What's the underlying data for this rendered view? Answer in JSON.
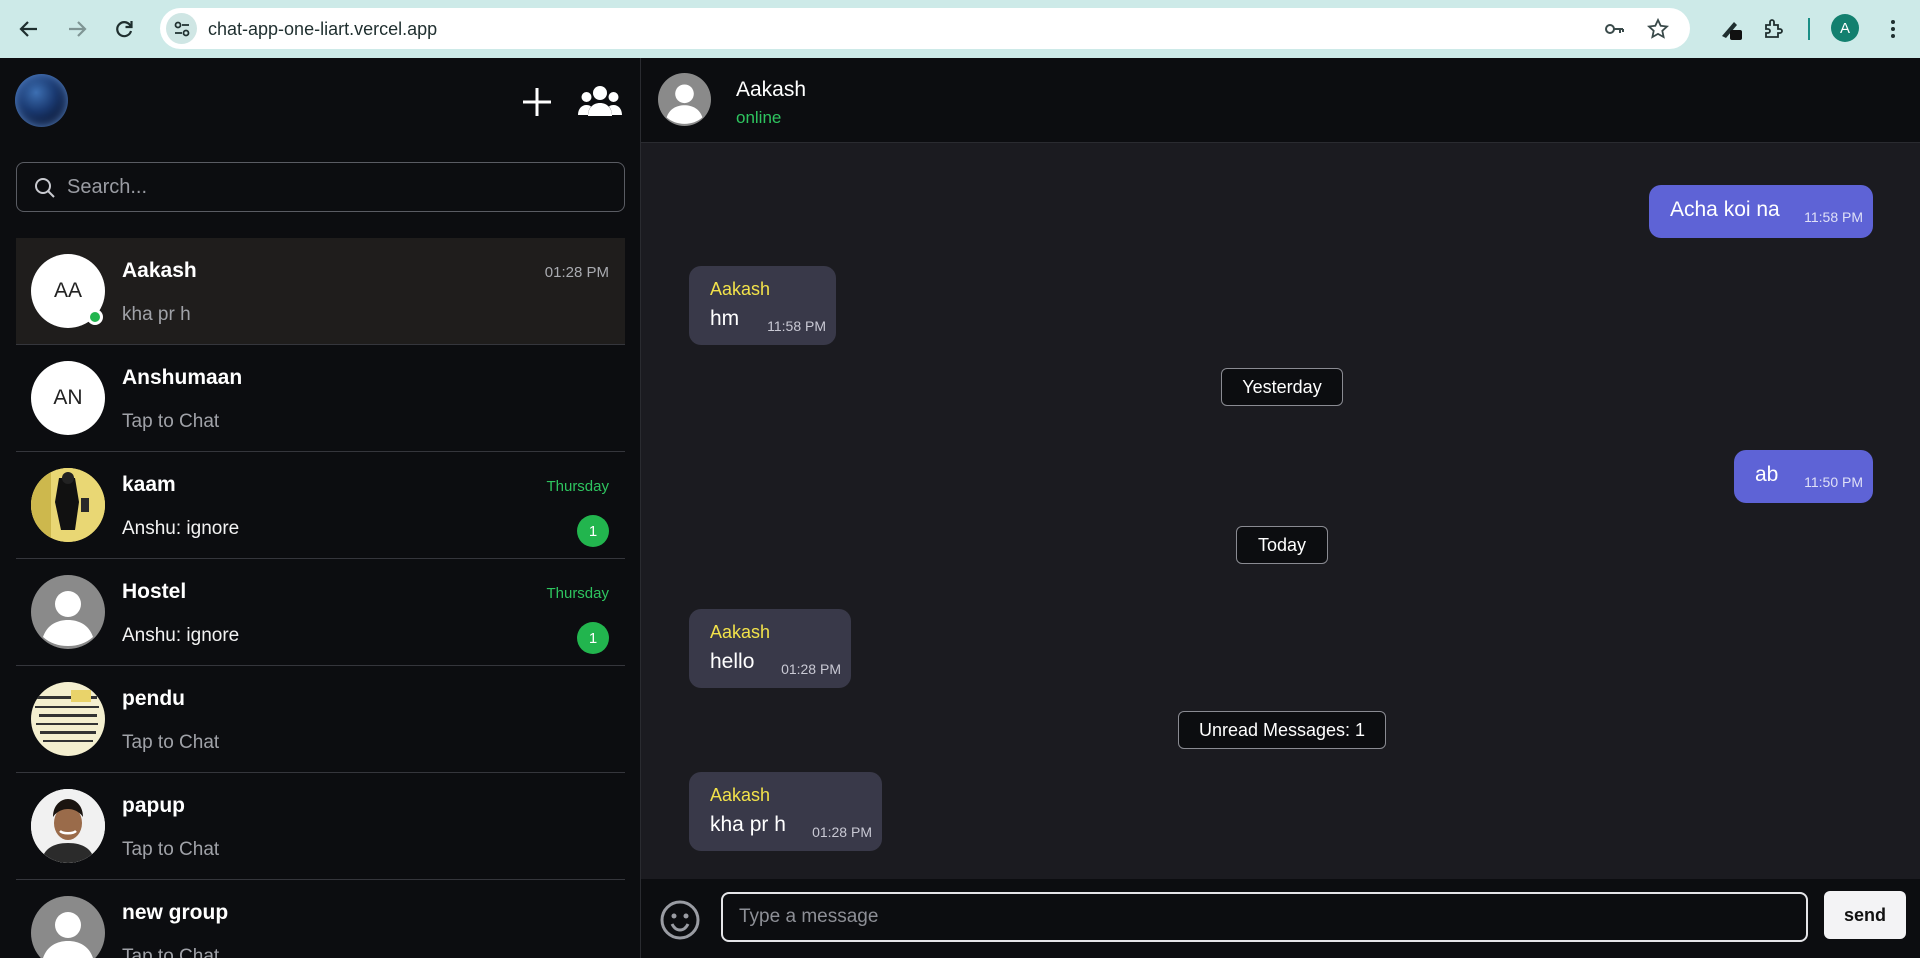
{
  "browser": {
    "url": "chat-app-one-liart.vercel.app",
    "profile_initial": "A"
  },
  "sidebar": {
    "search_placeholder": "Search...",
    "chats": [
      {
        "name": "Aakash",
        "initials": "AA",
        "time": "01:28 PM",
        "preview": "kha pr h",
        "online": true,
        "active": true
      },
      {
        "name": "Anshumaan",
        "initials": "AN",
        "time": "",
        "preview": "Tap to Chat"
      },
      {
        "name": "kaam",
        "time": "Thursday",
        "preview": "Anshu: ignore",
        "unread": "1"
      },
      {
        "name": "Hostel",
        "time": "Thursday",
        "preview": "Anshu: ignore",
        "unread": "1"
      },
      {
        "name": "pendu",
        "time": "",
        "preview": "Tap to Chat"
      },
      {
        "name": "papup",
        "time": "",
        "preview": "Tap to Chat"
      },
      {
        "name": "new group",
        "time": "",
        "preview": "Tap to Chat"
      }
    ]
  },
  "chat": {
    "header": {
      "name": "Aakash",
      "status": "online"
    },
    "messages": [
      {
        "text": "Acha koi na",
        "time": "11:58 PM",
        "mine": true
      },
      {
        "sender": "Aakash",
        "text": "hm",
        "time": "11:58 PM"
      },
      {
        "divider": "Yesterday"
      },
      {
        "text": "ab",
        "time": "11:50 PM",
        "mine": true
      },
      {
        "divider": "Today"
      },
      {
        "sender": "Aakash",
        "text": "hello",
        "time": "01:28 PM"
      },
      {
        "divider": "Unread Messages: 1"
      },
      {
        "sender": "Aakash",
        "text": "kha pr h",
        "time": "01:28 PM"
      }
    ],
    "composer": {
      "placeholder": "Type a message",
      "send_label": "send"
    }
  },
  "colors": {
    "accent_bubble": "#5e63d6",
    "incoming_bubble": "#393949",
    "online_green": "#22b54e",
    "sender_yellow": "#f2e24a"
  }
}
